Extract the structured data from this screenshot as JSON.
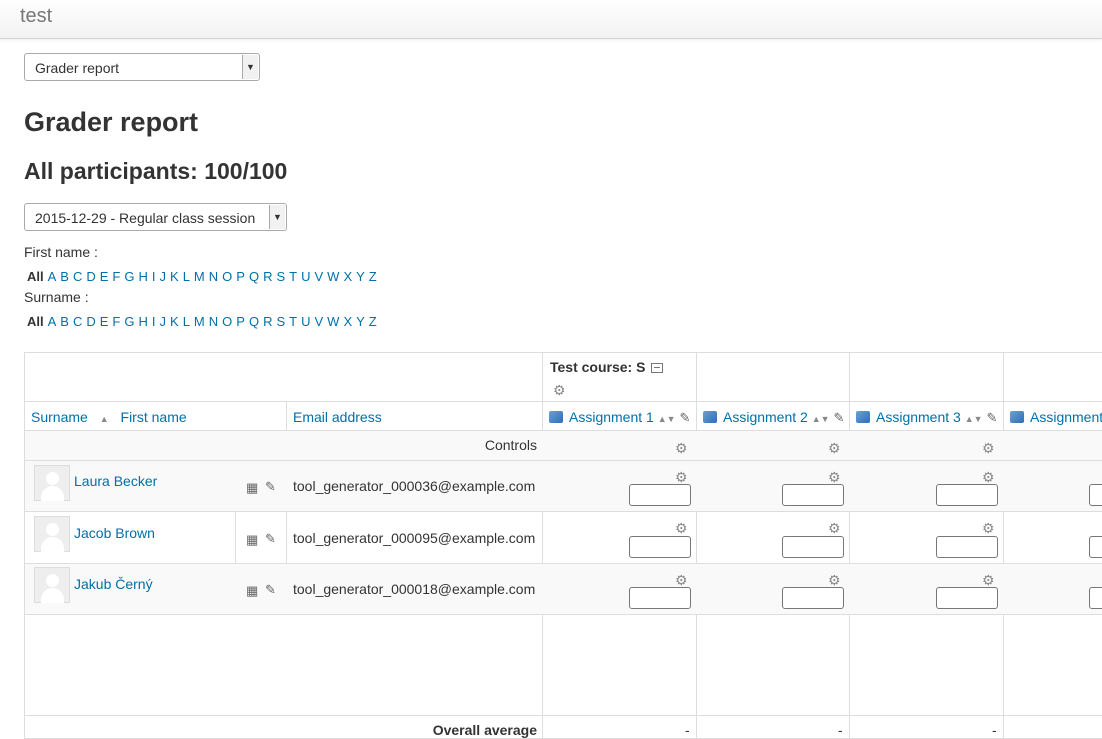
{
  "app": {
    "title": "test"
  },
  "report_select": {
    "value": "Grader report"
  },
  "page_title": "Grader report",
  "participants": "All participants: 100/100",
  "session_select": {
    "value": "2015-12-29 - Regular class session"
  },
  "filters": {
    "first_name_label": "First name :",
    "surname_label": "Surname :",
    "all_label": "All",
    "letters": [
      "A",
      "B",
      "C",
      "D",
      "E",
      "F",
      "G",
      "H",
      "I",
      "J",
      "K",
      "L",
      "M",
      "N",
      "O",
      "P",
      "Q",
      "R",
      "S",
      "T",
      "U",
      "V",
      "W",
      "X",
      "Y",
      "Z"
    ]
  },
  "table": {
    "course_header": "Test course: S",
    "col_surname": "Surname",
    "col_firstname": "First name",
    "col_email": "Email address",
    "assignments": [
      "Assignment 1",
      "Assignment 2",
      "Assignment 3",
      "Assignment"
    ],
    "controls_label": "Controls",
    "rows": [
      {
        "name": "Laura Becker",
        "email": "tool_generator_000036@example.com"
      },
      {
        "name": "Jacob Brown",
        "email": "tool_generator_000095@example.com"
      },
      {
        "name": "Jakub Černý",
        "email": "tool_generator_000018@example.com"
      }
    ],
    "overall_label": "Overall average",
    "overall_values": [
      "-",
      "-",
      "-"
    ]
  },
  "icons": {
    "gear": "gear-icon",
    "sort": "sort-icon",
    "edit": "pencil-icon",
    "report": "grid-icon",
    "assignment": "assignment-icon",
    "collapse": "collapse-icon"
  }
}
